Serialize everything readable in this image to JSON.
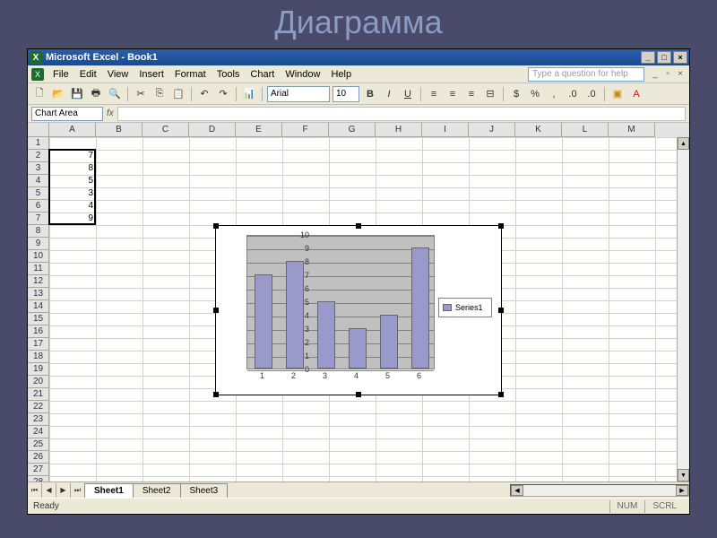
{
  "slide": {
    "title": "Диаграмма"
  },
  "window": {
    "title": "Microsoft Excel - Book1",
    "help_placeholder": "Type a question for help"
  },
  "menu": {
    "file": "File",
    "edit": "Edit",
    "view": "View",
    "insert": "Insert",
    "format": "Format",
    "tools": "Tools",
    "chart": "Chart",
    "window": "Window",
    "help": "Help"
  },
  "toolbar": {
    "font_name": "Arial",
    "font_size": "10"
  },
  "name_box": "Chart Area",
  "columns": [
    "A",
    "B",
    "C",
    "D",
    "E",
    "F",
    "G",
    "H",
    "I",
    "J",
    "K",
    "L",
    "M"
  ],
  "row_count": 31,
  "cells": {
    "A2": "7",
    "A3": "8",
    "A4": "5",
    "A5": "3",
    "A6": "4",
    "A7": "9"
  },
  "tabs": {
    "active": "Sheet1",
    "items": [
      "Sheet1",
      "Sheet2",
      "Sheet3"
    ]
  },
  "status": {
    "ready": "Ready",
    "numlock": "NUM",
    "scrlock": "SCRL"
  },
  "chart_data": {
    "type": "bar",
    "categories": [
      "1",
      "2",
      "3",
      "4",
      "5",
      "6"
    ],
    "values": [
      7,
      8,
      5,
      3,
      4,
      9
    ],
    "series_name": "Series1",
    "ylim": [
      0,
      10
    ],
    "yticks": [
      0,
      1,
      2,
      3,
      4,
      5,
      6,
      7,
      8,
      9,
      10
    ]
  }
}
